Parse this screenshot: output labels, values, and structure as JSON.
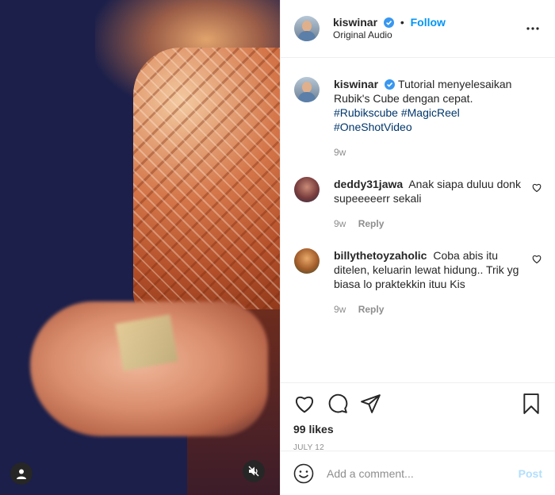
{
  "header": {
    "username": "kiswinar",
    "follow_label": "Follow",
    "dot": "•",
    "audio": "Original Audio",
    "icons": {
      "verified": "verified-badge-icon",
      "more": "more-options-icon"
    }
  },
  "caption": {
    "username": "kiswinar",
    "text": "Tutorial menyelesaikan Rubik's Cube dengan cepat.",
    "tags": [
      "#Rubikscube",
      "#MagicReel",
      "#OneShotVideo"
    ],
    "time": "9w"
  },
  "comments": [
    {
      "username": "deddy31jawa",
      "text": "Anak siapa duluu donk supeeeeerr sekali",
      "time": "9w",
      "reply_label": "Reply"
    },
    {
      "username": "billythetoyzaholic",
      "text": "Coba abis itu ditelen, keluarin lewat hidung.. Trik yg biasa lo praktekkin ituu Kis",
      "time": "9w",
      "reply_label": "Reply"
    }
  ],
  "actions": {
    "likes": "99 likes",
    "date": "JULY 12",
    "icons": [
      "like-heart-icon",
      "comment-icon",
      "share-icon",
      "bookmark-icon"
    ]
  },
  "add_comment": {
    "placeholder": "Add a comment...",
    "post_label": "Post"
  },
  "colors": {
    "link_blue": "#0095f6",
    "hashtag": "#00376b",
    "muted": "#8e8e8e",
    "post_disabled": "#b2dffc"
  }
}
